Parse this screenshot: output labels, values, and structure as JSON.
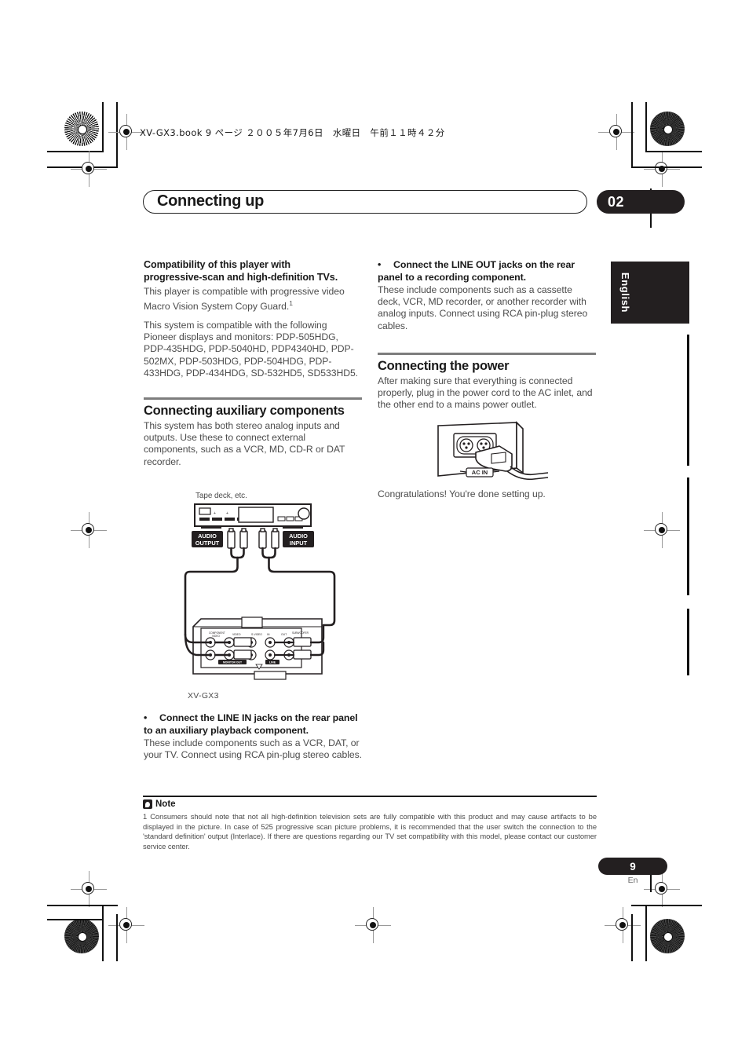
{
  "page": {
    "file_info": "XV-GX3.book  9 ページ  ２００５年7月6日　水曜日　午前１１時４２分",
    "chapter_title": "Connecting up",
    "chapter_number": "02",
    "language_tab": "English",
    "page_number": "9",
    "page_lang_code": "En"
  },
  "left_column": {
    "subhead_line1": "Compatibility of this player with",
    "subhead_line2": "progressive-scan and high-definition TVs.",
    "para1_prefix": "This player is compatible with progressive video Macro Vision System Copy Guard.",
    "para1_footnote": "1",
    "para2": "This system is compatible with the following Pioneer displays and monitors: PDP-505HDG, PDP-435HDG, PDP-5040HD, PDP4340HD, PDP-502MX, PDP-503HDG, PDP-504HDG, PDP-433HDG, PDP-434HDG, SD-532HD5, SD533HD5.",
    "section_heading": "Connecting auxiliary components",
    "section_para": "This system has both stereo analog inputs and outputs. Use these to connect external components, such as a VCR, MD, CD-R or DAT recorder.",
    "bullet_dot": "•",
    "bullet_heading": "Connect the LINE IN jacks on the rear panel to an auxiliary playback component.",
    "bullet_body": "These include components such as a VCR, DAT, or your TV. Connect using RCA pin-plug stereo cables."
  },
  "right_column": {
    "bullet_dot": "•",
    "bullet_heading": "Connect the LINE OUT jacks on the rear panel to a recording component.",
    "bullet_body": "These include components such as a cassette deck, VCR, MD recorder, or another recorder with analog inputs. Connect using RCA pin-plug stereo cables.",
    "section_heading": "Connecting the power",
    "section_para": "After making sure that everything is connected properly, plug in the power cord to the AC inlet, and the other end to a mains power outlet.",
    "closing_para": "Congratulations! You're done setting up."
  },
  "diagram": {
    "device_caption": "Tape deck, etc.",
    "audio_output_label_line1": "AUDIO",
    "audio_output_label_line2": "OUTPUT",
    "audio_input_label_line1": "AUDIO",
    "audio_input_label_line2": "INPUT",
    "player_model_caption": "XV-GX3",
    "rear_panel": {
      "component_video_label": "COMPONENT VIDEO",
      "video_label": "VIDEO",
      "svideo_label": "S-VIDEO",
      "in_label": "IN",
      "out_label": "OUT",
      "subwoofer_label": "SUBWOOFER",
      "monitor_out_label": "MONITOR OUT",
      "line_label": "LINE"
    }
  },
  "power_diagram": {
    "ac_in_label": "AC IN"
  },
  "note": {
    "title": "Note",
    "body": "1 Consumers should note that not all high-definition television sets are fully compatible with this product and may cause artifacts to be displayed in the picture. In case of 525 progressive scan picture problems, it is recommended that the user switch the connection to the 'standard definition' output (Interlace). If there are questions regarding our TV set compatibility with this model, please contact our customer service center."
  },
  "colors": {
    "ink": "#231f20",
    "body_text": "#4c4c4c",
    "rule": "#7d7d7d"
  }
}
